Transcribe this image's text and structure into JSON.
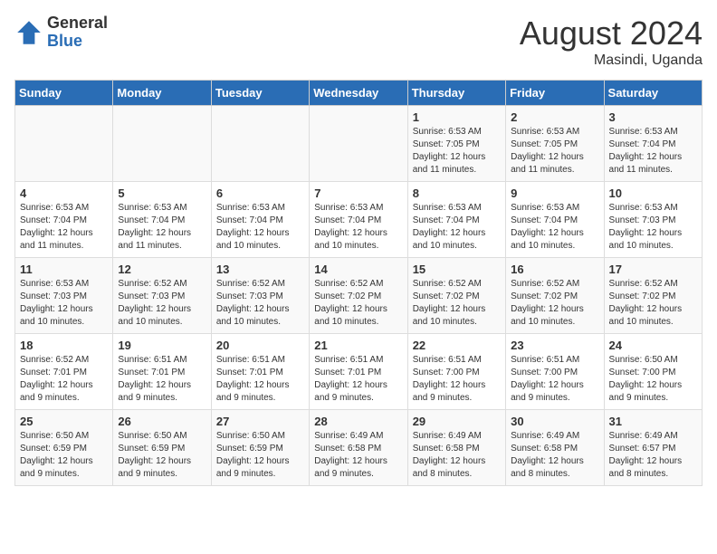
{
  "header": {
    "logo_general": "General",
    "logo_blue": "Blue",
    "month_title": "August 2024",
    "location": "Masindi, Uganda"
  },
  "days_of_week": [
    "Sunday",
    "Monday",
    "Tuesday",
    "Wednesday",
    "Thursday",
    "Friday",
    "Saturday"
  ],
  "weeks": [
    [
      {
        "day": "",
        "info": ""
      },
      {
        "day": "",
        "info": ""
      },
      {
        "day": "",
        "info": ""
      },
      {
        "day": "",
        "info": ""
      },
      {
        "day": "1",
        "info": "Sunrise: 6:53 AM\nSunset: 7:05 PM\nDaylight: 12 hours\nand 11 minutes."
      },
      {
        "day": "2",
        "info": "Sunrise: 6:53 AM\nSunset: 7:05 PM\nDaylight: 12 hours\nand 11 minutes."
      },
      {
        "day": "3",
        "info": "Sunrise: 6:53 AM\nSunset: 7:04 PM\nDaylight: 12 hours\nand 11 minutes."
      }
    ],
    [
      {
        "day": "4",
        "info": "Sunrise: 6:53 AM\nSunset: 7:04 PM\nDaylight: 12 hours\nand 11 minutes."
      },
      {
        "day": "5",
        "info": "Sunrise: 6:53 AM\nSunset: 7:04 PM\nDaylight: 12 hours\nand 11 minutes."
      },
      {
        "day": "6",
        "info": "Sunrise: 6:53 AM\nSunset: 7:04 PM\nDaylight: 12 hours\nand 10 minutes."
      },
      {
        "day": "7",
        "info": "Sunrise: 6:53 AM\nSunset: 7:04 PM\nDaylight: 12 hours\nand 10 minutes."
      },
      {
        "day": "8",
        "info": "Sunrise: 6:53 AM\nSunset: 7:04 PM\nDaylight: 12 hours\nand 10 minutes."
      },
      {
        "day": "9",
        "info": "Sunrise: 6:53 AM\nSunset: 7:04 PM\nDaylight: 12 hours\nand 10 minutes."
      },
      {
        "day": "10",
        "info": "Sunrise: 6:53 AM\nSunset: 7:03 PM\nDaylight: 12 hours\nand 10 minutes."
      }
    ],
    [
      {
        "day": "11",
        "info": "Sunrise: 6:53 AM\nSunset: 7:03 PM\nDaylight: 12 hours\nand 10 minutes."
      },
      {
        "day": "12",
        "info": "Sunrise: 6:52 AM\nSunset: 7:03 PM\nDaylight: 12 hours\nand 10 minutes."
      },
      {
        "day": "13",
        "info": "Sunrise: 6:52 AM\nSunset: 7:03 PM\nDaylight: 12 hours\nand 10 minutes."
      },
      {
        "day": "14",
        "info": "Sunrise: 6:52 AM\nSunset: 7:02 PM\nDaylight: 12 hours\nand 10 minutes."
      },
      {
        "day": "15",
        "info": "Sunrise: 6:52 AM\nSunset: 7:02 PM\nDaylight: 12 hours\nand 10 minutes."
      },
      {
        "day": "16",
        "info": "Sunrise: 6:52 AM\nSunset: 7:02 PM\nDaylight: 12 hours\nand 10 minutes."
      },
      {
        "day": "17",
        "info": "Sunrise: 6:52 AM\nSunset: 7:02 PM\nDaylight: 12 hours\nand 10 minutes."
      }
    ],
    [
      {
        "day": "18",
        "info": "Sunrise: 6:52 AM\nSunset: 7:01 PM\nDaylight: 12 hours\nand 9 minutes."
      },
      {
        "day": "19",
        "info": "Sunrise: 6:51 AM\nSunset: 7:01 PM\nDaylight: 12 hours\nand 9 minutes."
      },
      {
        "day": "20",
        "info": "Sunrise: 6:51 AM\nSunset: 7:01 PM\nDaylight: 12 hours\nand 9 minutes."
      },
      {
        "day": "21",
        "info": "Sunrise: 6:51 AM\nSunset: 7:01 PM\nDaylight: 12 hours\nand 9 minutes."
      },
      {
        "day": "22",
        "info": "Sunrise: 6:51 AM\nSunset: 7:00 PM\nDaylight: 12 hours\nand 9 minutes."
      },
      {
        "day": "23",
        "info": "Sunrise: 6:51 AM\nSunset: 7:00 PM\nDaylight: 12 hours\nand 9 minutes."
      },
      {
        "day": "24",
        "info": "Sunrise: 6:50 AM\nSunset: 7:00 PM\nDaylight: 12 hours\nand 9 minutes."
      }
    ],
    [
      {
        "day": "25",
        "info": "Sunrise: 6:50 AM\nSunset: 6:59 PM\nDaylight: 12 hours\nand 9 minutes."
      },
      {
        "day": "26",
        "info": "Sunrise: 6:50 AM\nSunset: 6:59 PM\nDaylight: 12 hours\nand 9 minutes."
      },
      {
        "day": "27",
        "info": "Sunrise: 6:50 AM\nSunset: 6:59 PM\nDaylight: 12 hours\nand 9 minutes."
      },
      {
        "day": "28",
        "info": "Sunrise: 6:49 AM\nSunset: 6:58 PM\nDaylight: 12 hours\nand 9 minutes."
      },
      {
        "day": "29",
        "info": "Sunrise: 6:49 AM\nSunset: 6:58 PM\nDaylight: 12 hours\nand 8 minutes."
      },
      {
        "day": "30",
        "info": "Sunrise: 6:49 AM\nSunset: 6:58 PM\nDaylight: 12 hours\nand 8 minutes."
      },
      {
        "day": "31",
        "info": "Sunrise: 6:49 AM\nSunset: 6:57 PM\nDaylight: 12 hours\nand 8 minutes."
      }
    ]
  ]
}
